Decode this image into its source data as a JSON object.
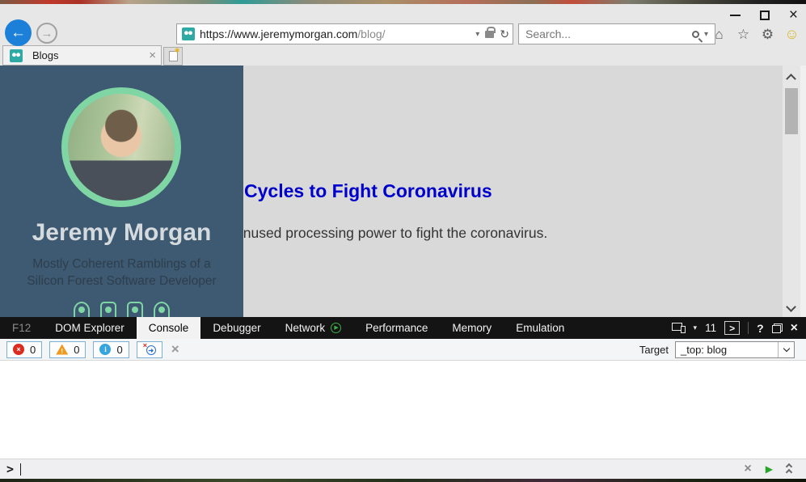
{
  "browser": {
    "url": {
      "scheme_host": "https://www.jeremymorgan.com",
      "path": "/blog/"
    },
    "search_placeholder": "Search...",
    "tab_title": "Blogs"
  },
  "page": {
    "article": {
      "heading": "Cycles to Fight Coronavirus",
      "excerpt": "unused processing power to fight the coronavirus."
    },
    "sidebar": {
      "name": "Jeremy Morgan",
      "tagline_line1": "Mostly Coherent Ramblings of a",
      "tagline_line2": "Silicon Forest Software Developer"
    }
  },
  "devtools": {
    "tabs": [
      {
        "label": "F12"
      },
      {
        "label": "DOM Explorer"
      },
      {
        "label": "Console",
        "active": true
      },
      {
        "label": "Debugger"
      },
      {
        "label": "Network"
      },
      {
        "label": "Performance"
      },
      {
        "label": "Memory"
      },
      {
        "label": "Emulation"
      }
    ],
    "document_mode": "11",
    "counts": {
      "errors": "0",
      "warnings": "0",
      "messages": "0"
    },
    "target_label": "Target",
    "target_value": "_top: blog"
  },
  "icons": {
    "back_arrow": "←",
    "forward_arrow": "→",
    "dropdown_caret": "▾",
    "refresh": "↻",
    "home": "⌂",
    "favorites_star": "☆",
    "settings_gear": "⚙",
    "smiley": "☺",
    "close_x": "×",
    "tab_close": "×",
    "play": "▶",
    "question": "?",
    "console_chevron": ">",
    "error_x": "×",
    "warning_bang": "!",
    "info_i": "i",
    "nav_arrow": "➜",
    "nav_red_x": "×",
    "prompt_chevron": ">"
  },
  "colors": {
    "sidebar_bg": "#3d5a72",
    "avatar_ring": "#7fd6a4",
    "heading_blue": "#0000cc",
    "back_button_blue": "#1d80d8",
    "error_red": "#db2b1e",
    "warning_orange": "#f09a1f",
    "info_blue": "#36a5dd",
    "network_green": "#3fae49",
    "page_bg": "#d9d9d9",
    "devtools_bar": "#141414"
  }
}
